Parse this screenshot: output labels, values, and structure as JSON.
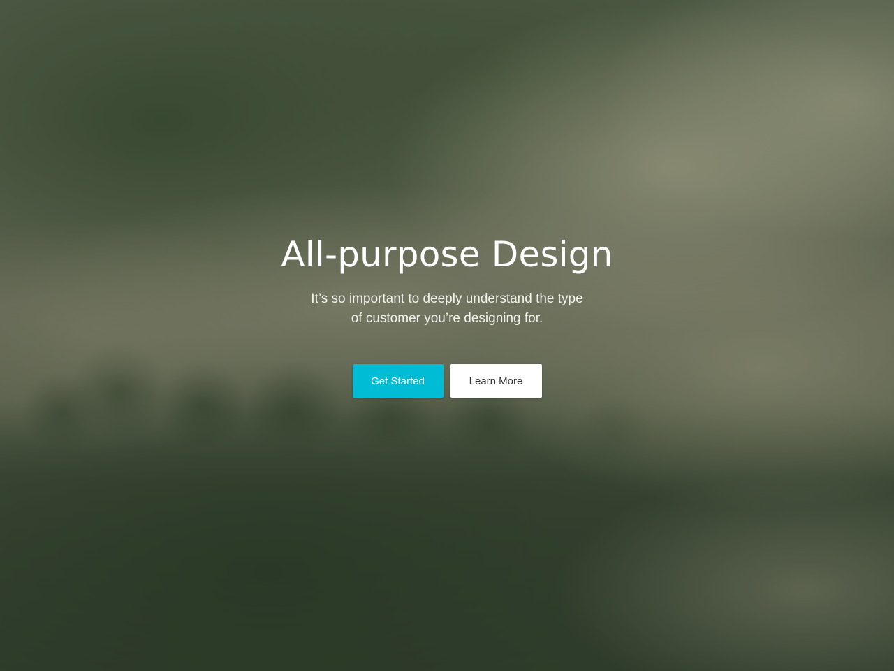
{
  "hero": {
    "title": "All-purpose Design",
    "subtitle": "It’s so important to deeply understand the type of customer you’re designing for.",
    "background": "misty-forest-photo"
  },
  "actions": {
    "primary_label": "Get Started",
    "secondary_label": "Learn More"
  },
  "colors": {
    "primary_button": "#00bcd4",
    "secondary_button": "#ffffff",
    "text": "#ffffff"
  }
}
